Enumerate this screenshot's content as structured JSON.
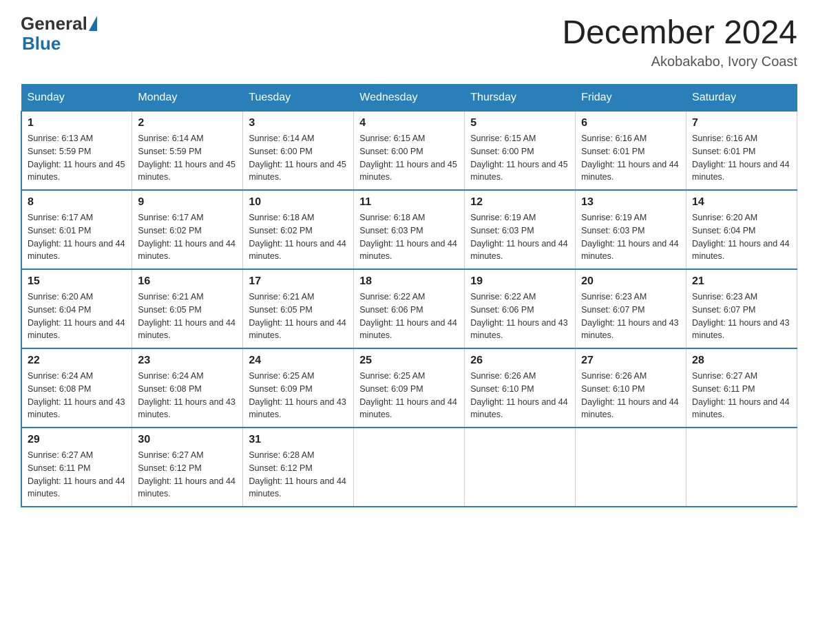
{
  "header": {
    "logo_general": "General",
    "logo_blue": "Blue",
    "month_title": "December 2024",
    "location": "Akobakabo, Ivory Coast"
  },
  "days_of_week": [
    "Sunday",
    "Monday",
    "Tuesday",
    "Wednesday",
    "Thursday",
    "Friday",
    "Saturday"
  ],
  "weeks": [
    [
      {
        "day": "1",
        "sunrise": "6:13 AM",
        "sunset": "5:59 PM",
        "daylight": "11 hours and 45 minutes."
      },
      {
        "day": "2",
        "sunrise": "6:14 AM",
        "sunset": "5:59 PM",
        "daylight": "11 hours and 45 minutes."
      },
      {
        "day": "3",
        "sunrise": "6:14 AM",
        "sunset": "6:00 PM",
        "daylight": "11 hours and 45 minutes."
      },
      {
        "day": "4",
        "sunrise": "6:15 AM",
        "sunset": "6:00 PM",
        "daylight": "11 hours and 45 minutes."
      },
      {
        "day": "5",
        "sunrise": "6:15 AM",
        "sunset": "6:00 PM",
        "daylight": "11 hours and 45 minutes."
      },
      {
        "day": "6",
        "sunrise": "6:16 AM",
        "sunset": "6:01 PM",
        "daylight": "11 hours and 44 minutes."
      },
      {
        "day": "7",
        "sunrise": "6:16 AM",
        "sunset": "6:01 PM",
        "daylight": "11 hours and 44 minutes."
      }
    ],
    [
      {
        "day": "8",
        "sunrise": "6:17 AM",
        "sunset": "6:01 PM",
        "daylight": "11 hours and 44 minutes."
      },
      {
        "day": "9",
        "sunrise": "6:17 AM",
        "sunset": "6:02 PM",
        "daylight": "11 hours and 44 minutes."
      },
      {
        "day": "10",
        "sunrise": "6:18 AM",
        "sunset": "6:02 PM",
        "daylight": "11 hours and 44 minutes."
      },
      {
        "day": "11",
        "sunrise": "6:18 AM",
        "sunset": "6:03 PM",
        "daylight": "11 hours and 44 minutes."
      },
      {
        "day": "12",
        "sunrise": "6:19 AM",
        "sunset": "6:03 PM",
        "daylight": "11 hours and 44 minutes."
      },
      {
        "day": "13",
        "sunrise": "6:19 AM",
        "sunset": "6:03 PM",
        "daylight": "11 hours and 44 minutes."
      },
      {
        "day": "14",
        "sunrise": "6:20 AM",
        "sunset": "6:04 PM",
        "daylight": "11 hours and 44 minutes."
      }
    ],
    [
      {
        "day": "15",
        "sunrise": "6:20 AM",
        "sunset": "6:04 PM",
        "daylight": "11 hours and 44 minutes."
      },
      {
        "day": "16",
        "sunrise": "6:21 AM",
        "sunset": "6:05 PM",
        "daylight": "11 hours and 44 minutes."
      },
      {
        "day": "17",
        "sunrise": "6:21 AM",
        "sunset": "6:05 PM",
        "daylight": "11 hours and 44 minutes."
      },
      {
        "day": "18",
        "sunrise": "6:22 AM",
        "sunset": "6:06 PM",
        "daylight": "11 hours and 44 minutes."
      },
      {
        "day": "19",
        "sunrise": "6:22 AM",
        "sunset": "6:06 PM",
        "daylight": "11 hours and 43 minutes."
      },
      {
        "day": "20",
        "sunrise": "6:23 AM",
        "sunset": "6:07 PM",
        "daylight": "11 hours and 43 minutes."
      },
      {
        "day": "21",
        "sunrise": "6:23 AM",
        "sunset": "6:07 PM",
        "daylight": "11 hours and 43 minutes."
      }
    ],
    [
      {
        "day": "22",
        "sunrise": "6:24 AM",
        "sunset": "6:08 PM",
        "daylight": "11 hours and 43 minutes."
      },
      {
        "day": "23",
        "sunrise": "6:24 AM",
        "sunset": "6:08 PM",
        "daylight": "11 hours and 43 minutes."
      },
      {
        "day": "24",
        "sunrise": "6:25 AM",
        "sunset": "6:09 PM",
        "daylight": "11 hours and 43 minutes."
      },
      {
        "day": "25",
        "sunrise": "6:25 AM",
        "sunset": "6:09 PM",
        "daylight": "11 hours and 44 minutes."
      },
      {
        "day": "26",
        "sunrise": "6:26 AM",
        "sunset": "6:10 PM",
        "daylight": "11 hours and 44 minutes."
      },
      {
        "day": "27",
        "sunrise": "6:26 AM",
        "sunset": "6:10 PM",
        "daylight": "11 hours and 44 minutes."
      },
      {
        "day": "28",
        "sunrise": "6:27 AM",
        "sunset": "6:11 PM",
        "daylight": "11 hours and 44 minutes."
      }
    ],
    [
      {
        "day": "29",
        "sunrise": "6:27 AM",
        "sunset": "6:11 PM",
        "daylight": "11 hours and 44 minutes."
      },
      {
        "day": "30",
        "sunrise": "6:27 AM",
        "sunset": "6:12 PM",
        "daylight": "11 hours and 44 minutes."
      },
      {
        "day": "31",
        "sunrise": "6:28 AM",
        "sunset": "6:12 PM",
        "daylight": "11 hours and 44 minutes."
      },
      null,
      null,
      null,
      null
    ]
  ]
}
